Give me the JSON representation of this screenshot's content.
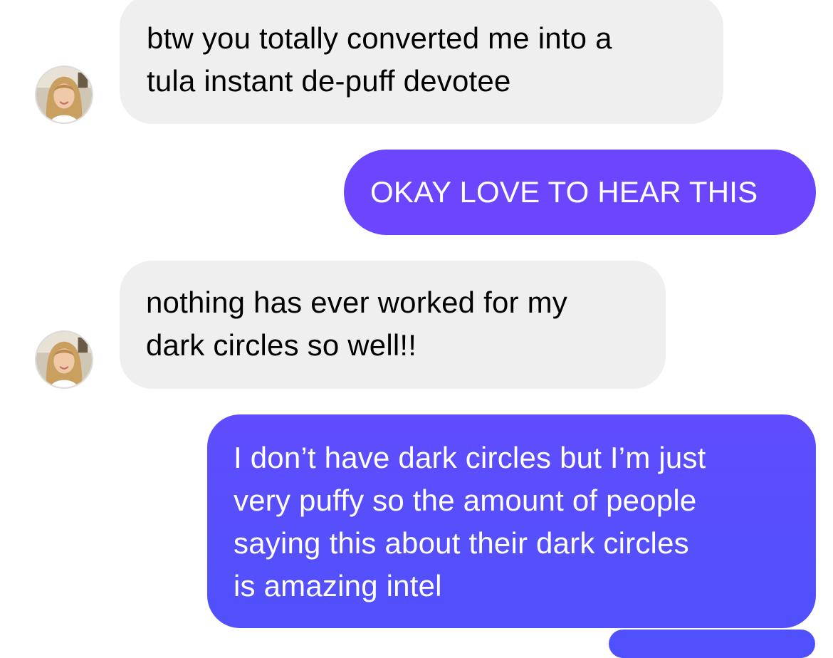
{
  "conversation": {
    "messages": [
      {
        "sender": "them",
        "lines": [
          "btw you totally converted me into a",
          "tula instant de-puff devotee"
        ]
      },
      {
        "sender": "me",
        "lines": [
          "OKAY LOVE TO HEAR THIS"
        ]
      },
      {
        "sender": "them",
        "lines": [
          "nothing has ever worked for my",
          "dark circles so well!!"
        ]
      },
      {
        "sender": "me",
        "lines": [
          "I don’t have dark circles but I’m just",
          "very puffy so the amount of people",
          "saying this about their dark circles",
          "is amazing intel"
        ]
      }
    ]
  },
  "colors": {
    "incoming_bubble": "#efefef",
    "outgoing_bubble_top": "#6b46fe",
    "outgoing_bubble_bottom": "#5051fc",
    "incoming_text": "#000000",
    "outgoing_text": "#ffffff"
  },
  "icons": {
    "avatar": "contact-avatar-photo"
  }
}
